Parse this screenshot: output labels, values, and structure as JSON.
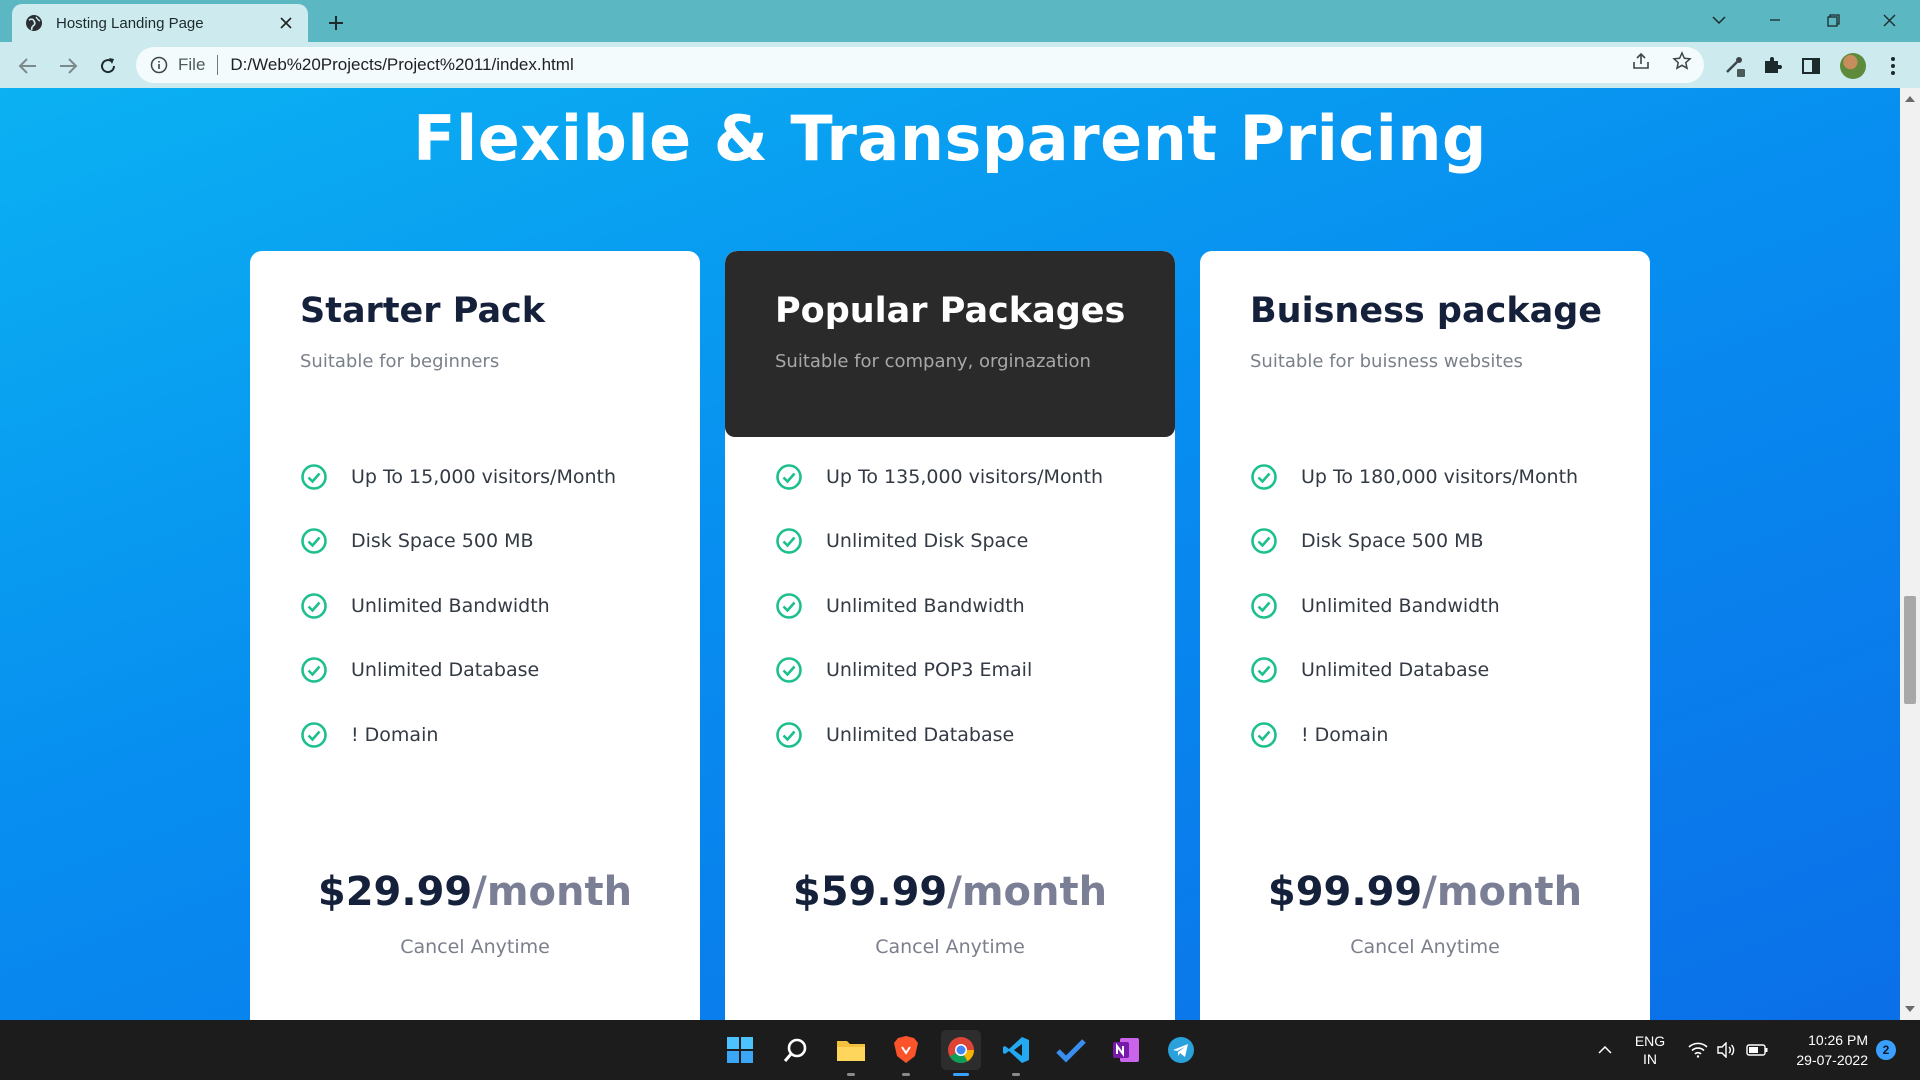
{
  "browser": {
    "tab_title": "Hosting Landing Page",
    "scheme_label": "File",
    "url": "D:/Web%20Projects/Project%2011/index.html"
  },
  "page": {
    "heading": "Flexible & Transparent Pricing",
    "plans": [
      {
        "name": "Starter Pack",
        "subtitle": "Suitable for beginners",
        "features": [
          "Up To 15,000 visitors/Month",
          "Disk Space 500 MB",
          "Unlimited Bandwidth",
          "Unlimited Database",
          "! Domain"
        ],
        "price": "$29.99",
        "period": "/month",
        "note": "Cancel Anytime"
      },
      {
        "name": "Popular Packages",
        "subtitle": "Suitable for company, orginazation",
        "features": [
          "Up To 135,000 visitors/Month",
          "Unlimited Disk Space",
          "Unlimited Bandwidth",
          "Unlimited POP3 Email",
          "Unlimited Database"
        ],
        "price": "$59.99",
        "period": "/month",
        "note": "Cancel Anytime"
      },
      {
        "name": "Buisness package",
        "subtitle": "Suitable for buisness websites",
        "features": [
          "Up To 180,000 visitors/Month",
          "Disk Space 500 MB",
          "Unlimited Bandwidth",
          "Unlimited Database",
          "! Domain"
        ],
        "price": "$99.99",
        "period": "/month",
        "note": "Cancel Anytime"
      }
    ]
  },
  "taskbar": {
    "apps": [
      "windows-start",
      "search",
      "file-explorer",
      "brave",
      "chrome",
      "vscode",
      "todo",
      "onenote",
      "telegram"
    ],
    "lang_top": "ENG",
    "lang_bottom": "IN",
    "time": "10:26 PM",
    "date": "29-07-2022",
    "notifications": "2"
  },
  "colors": {
    "accent_check": "#1dbf8e",
    "page_gradient_start": "#0bb1f2",
    "page_gradient_end": "#0b6fe8",
    "dark_card_header": "#2a2a2a",
    "price_text": "#15213a",
    "period_text": "#7b7f95"
  }
}
